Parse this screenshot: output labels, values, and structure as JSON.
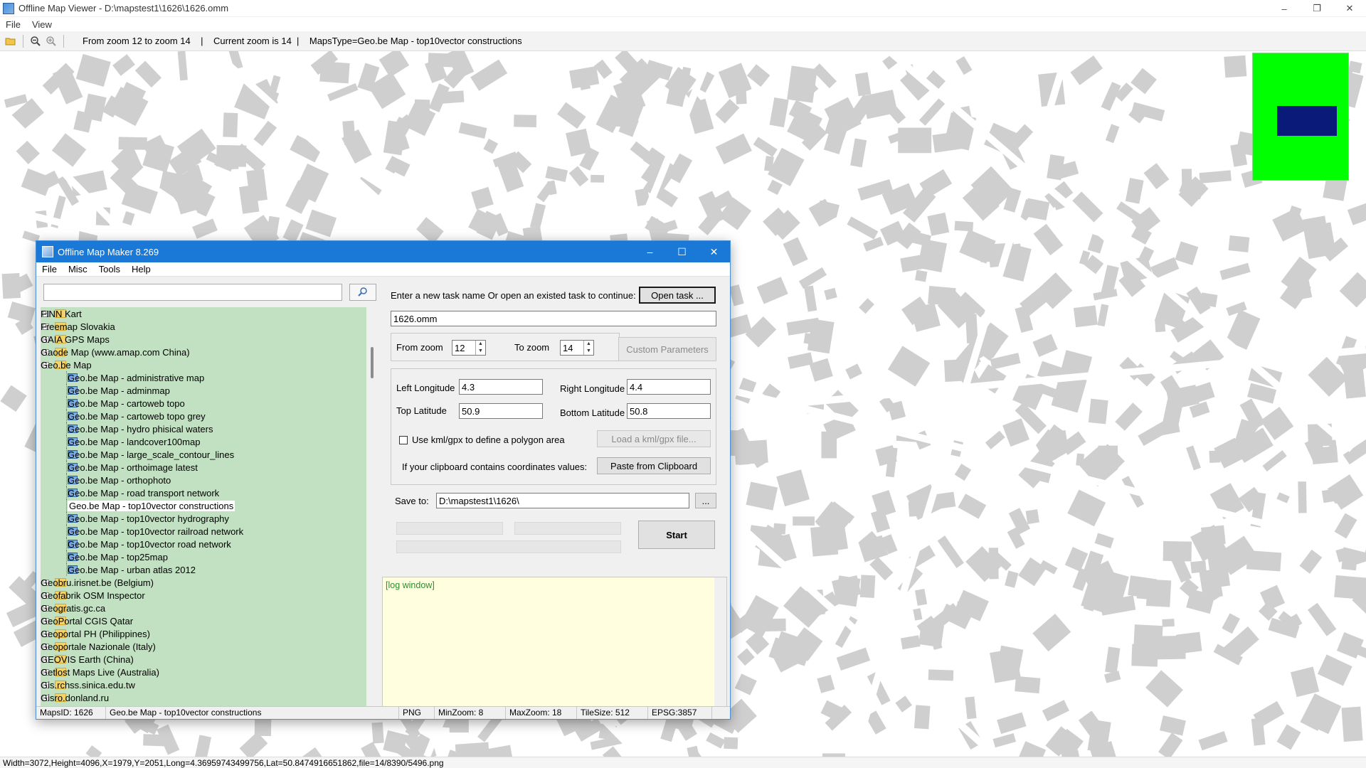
{
  "window": {
    "title": "Offline Map Viewer - D:\\mapstest1\\1626\\1626.omm"
  },
  "menu": [
    "File",
    "View"
  ],
  "toolbar": {
    "info": "From zoom 12 to zoom 14    |    Current zoom is 14  |    MapsType=Geo.be Map - top10vector constructions"
  },
  "statusbar": {
    "text": "Width=3072,Height=4096,X=1979,Y=2051,Long=4.36959743499756,Lat=50.8474916651862,file=14/8390/5496.png"
  },
  "dialog": {
    "title": "Offline Map Maker 8.269",
    "menu": [
      "File",
      "Misc",
      "Tools",
      "Help"
    ],
    "search": {
      "value": "",
      "placeholder": ""
    },
    "tree": [
      {
        "label": "FINN Kart",
        "type": "folder"
      },
      {
        "label": "Freemap Slovakia",
        "type": "folder"
      },
      {
        "label": "GAIA GPS Maps",
        "type": "folder"
      },
      {
        "label": "Gaode Map (www.amap.com China)",
        "type": "folder"
      },
      {
        "label": "Geo.be Map",
        "type": "folder-open"
      },
      {
        "label": "Geo.be Map - administrative map",
        "type": "map"
      },
      {
        "label": "Geo.be Map - adminmap",
        "type": "map"
      },
      {
        "label": "Geo.be Map - cartoweb topo",
        "type": "map"
      },
      {
        "label": "Geo.be Map - cartoweb topo grey",
        "type": "map"
      },
      {
        "label": "Geo.be Map - hydro phisical waters",
        "type": "map"
      },
      {
        "label": "Geo.be Map - landcover100map",
        "type": "map"
      },
      {
        "label": "Geo.be Map - large_scale_contour_lines",
        "type": "map"
      },
      {
        "label": "Geo.be Map - orthoimage latest",
        "type": "map"
      },
      {
        "label": "Geo.be Map - orthophoto",
        "type": "map"
      },
      {
        "label": "Geo.be Map - road transport network",
        "type": "map"
      },
      {
        "label": "Geo.be Map - top10vector constructions",
        "type": "map",
        "selected": true
      },
      {
        "label": "Geo.be Map - top10vector hydrography",
        "type": "map"
      },
      {
        "label": "Geo.be Map - top10vector railroad network",
        "type": "map"
      },
      {
        "label": "Geo.be Map - top10vector road network",
        "type": "map"
      },
      {
        "label": "Geo.be Map - top25map",
        "type": "map"
      },
      {
        "label": "Geo.be Map - urban atlas 2012",
        "type": "map"
      },
      {
        "label": "Geobru.irisnet.be (Belgium)",
        "type": "folder"
      },
      {
        "label": "Geofabrik OSM Inspector",
        "type": "folder"
      },
      {
        "label": "Geogratis.gc.ca",
        "type": "folder"
      },
      {
        "label": "GeoPortal CGIS Qatar",
        "type": "folder"
      },
      {
        "label": "Geoportal PH (Philippines)",
        "type": "folder"
      },
      {
        "label": "Geoportale Nazionale (Italy)",
        "type": "folder"
      },
      {
        "label": "GEOVIS Earth (China)",
        "type": "folder"
      },
      {
        "label": "Getlost Maps Live (Australia)",
        "type": "folder"
      },
      {
        "label": "Gis.rchss.sinica.edu.tw",
        "type": "folder"
      },
      {
        "label": "Gisro.donland.ru",
        "type": "folder"
      }
    ],
    "task_prompt": "Enter a new task name Or open an existed task to continue:",
    "open_task_label": "Open task ...",
    "task_name": "1626.omm",
    "from_zoom_label": "From zoom",
    "from_zoom": "12",
    "to_zoom_label": "To zoom",
    "to_zoom": "14",
    "custom_params_label": "Custom Parameters",
    "left_lon_label": "Left Longitude",
    "left_lon": "4.3",
    "right_lon_label": "Right Longitude",
    "right_lon": "4.4",
    "top_lat_label": "Top Latitude",
    "top_lat": "50.9",
    "bottom_lat_label": "Bottom Latitude",
    "bottom_lat": "50.8",
    "kml_label": "Use kml/gpx to define a polygon area",
    "load_kml_label": "Load a kml/gpx file...",
    "clipboard_prompt": "If your clipboard contains coordinates values:",
    "paste_label": "Paste from Clipboard",
    "save_to_label": "Save to:",
    "save_to": "D:\\mapstest1\\1626\\",
    "browse_label": "...",
    "start_label": "Start",
    "log_text": "[log window]",
    "status": {
      "maps_id": "MapsID: 1626",
      "map_name": "Geo.be Map - top10vector constructions",
      "format": "PNG",
      "min_zoom": "MinZoom: 8",
      "max_zoom": "MaxZoom: 18",
      "tile_size": "TileSize: 512",
      "epsg": "EPSG:3857"
    }
  },
  "colors": {
    "dialog_title_bg": "#1a78d6",
    "tree_bg": "#c2e0c2",
    "log_bg": "#ffffe0",
    "minimap_bg": "#00ff00",
    "minimap_viewport": "#0a1a78",
    "map_building": "#cfcfcf"
  }
}
